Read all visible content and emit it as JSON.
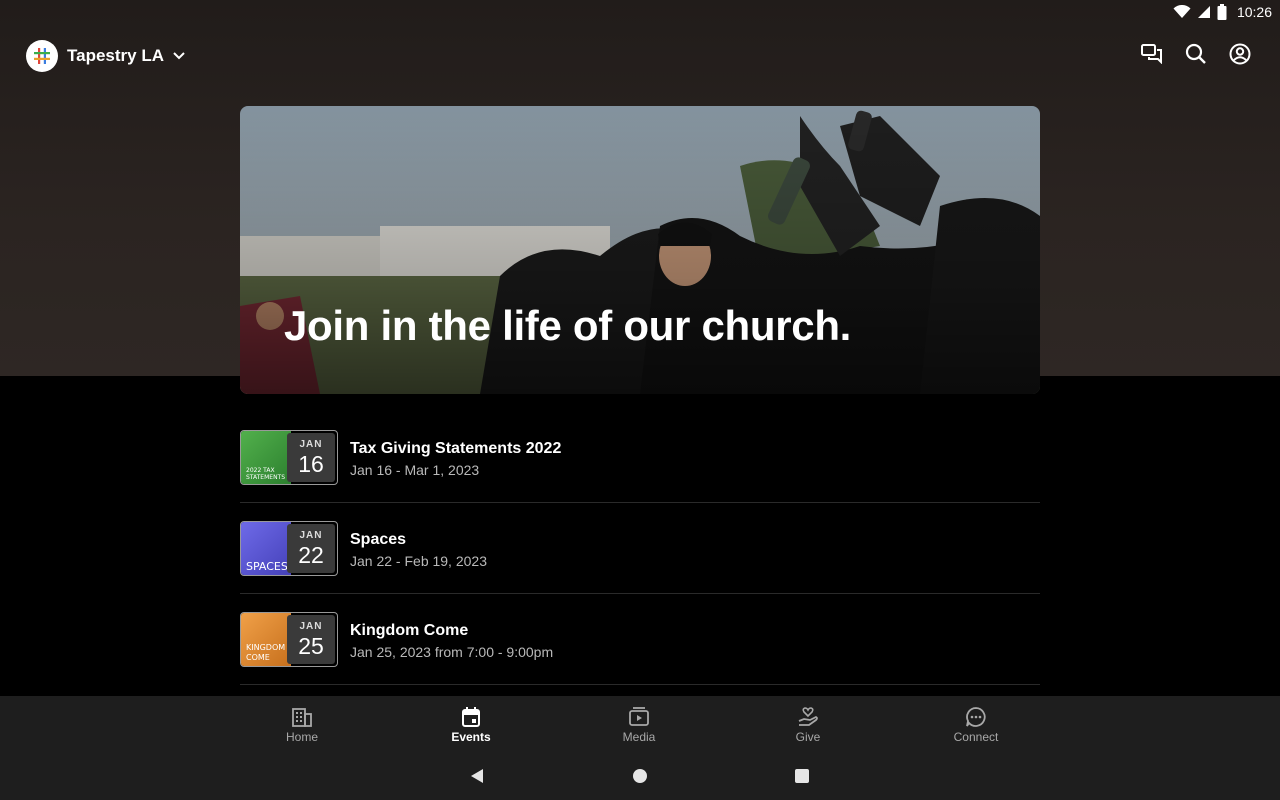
{
  "status_bar": {
    "time": "10:26"
  },
  "header": {
    "org_name": "Tapestry LA",
    "logo_icon": "tapestry-hash-logo",
    "actions": [
      "messages-icon",
      "search-icon",
      "profile-icon"
    ]
  },
  "hero": {
    "title": "Join in the life of our church."
  },
  "events": [
    {
      "title": "Tax Giving Statements 2022",
      "date": "Jan 16 - Mar 1, 2023",
      "month": "JAN",
      "day": "16",
      "thumb_color": "#3c9a3a",
      "caption": "2022 TAX\nSTATEMENTS"
    },
    {
      "title": "Spaces",
      "date": "Jan 22 - Feb 19, 2023",
      "month": "JAN",
      "day": "22",
      "thumb_color": "#5a56d6",
      "caption": "SPACES"
    },
    {
      "title": "Kingdom Come",
      "date": "Jan 25, 2023 from 7:00 - 9:00pm",
      "month": "JAN",
      "day": "25",
      "thumb_color": "#e08a2c",
      "caption": "KINGDOM\nCOME"
    }
  ],
  "bottom_nav": [
    {
      "label": "Home",
      "icon": "building-icon",
      "active": false
    },
    {
      "label": "Events",
      "icon": "calendar-icon",
      "active": true
    },
    {
      "label": "Media",
      "icon": "media-play-icon",
      "active": false
    },
    {
      "label": "Give",
      "icon": "hand-heart-icon",
      "active": false
    },
    {
      "label": "Connect",
      "icon": "chat-bubble-icon",
      "active": false
    }
  ]
}
